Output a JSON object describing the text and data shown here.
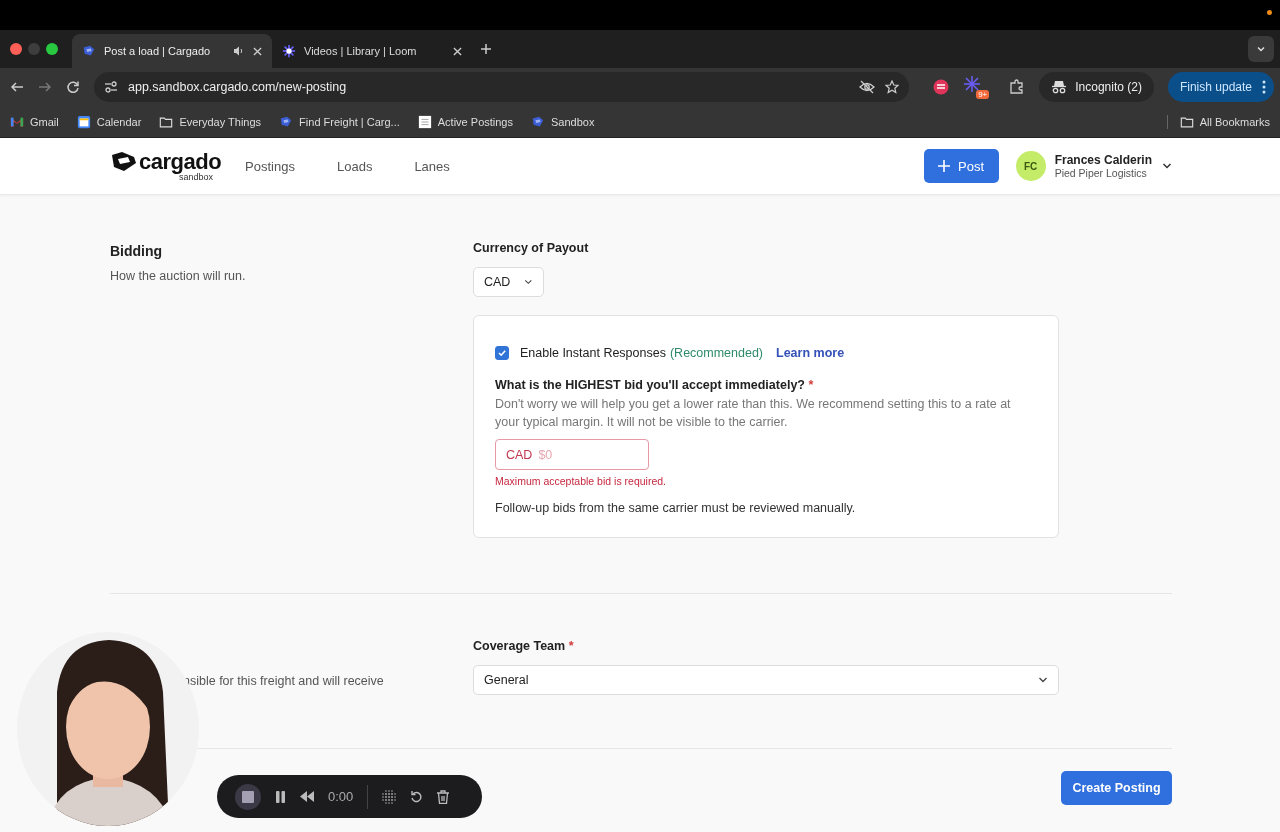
{
  "browser": {
    "tabs": [
      {
        "title": "Post a load | Cargado",
        "selected": true,
        "kind": "cargado"
      },
      {
        "title": "Videos | Library | Loom",
        "selected": false,
        "kind": "loom"
      }
    ],
    "url": "app.sandbox.cargado.com/new-posting",
    "extension_badge": "9+",
    "incognito": "Incognito (2)",
    "update_button": "Finish update",
    "bookmarks": [
      {
        "label": "Gmail",
        "kind": "gmail"
      },
      {
        "label": "Calendar",
        "kind": "calendar"
      },
      {
        "label": "Everyday Things",
        "kind": "folder"
      },
      {
        "label": "Find Freight | Carg...",
        "kind": "cargado"
      },
      {
        "label": "Active Postings",
        "kind": "page"
      },
      {
        "label": "Sandbox",
        "kind": "cargado"
      }
    ],
    "all_bookmarks": "All Bookmarks"
  },
  "header": {
    "logo": "cargado",
    "logo_sub": "sandbox",
    "nav": [
      "Postings",
      "Loads",
      "Lanes"
    ],
    "post_button": "Post",
    "user": {
      "initials": "FC",
      "name": "Frances Calderin",
      "company": "Pied Piper Logistics"
    }
  },
  "bidding": {
    "title": "Bidding",
    "description": "How the auction will run.",
    "currency_label": "Currency of Payout",
    "currency": "CAD",
    "instant": {
      "checked": true,
      "label": "Enable Instant Responses",
      "recommended": "(Recommended)",
      "link": "Learn more"
    },
    "question": "What is the HIGHEST bid you'll accept immediately?",
    "required": "*",
    "help": "Don't worry we will help you get a lower rate than this. We recommend setting this to a rate at your typical margin. It will not be visible to the carrier.",
    "bid_field": {
      "prefix": "CAD",
      "placeholder": "$0"
    },
    "error": "Maximum acceptable bid is required.",
    "note": "Follow-up bids from the same carrier must be reviewed manually."
  },
  "coverage": {
    "description": "nsible for this freight and will receive",
    "label": "Coverage Team",
    "required": "*",
    "value": "General"
  },
  "create_button": "Create Posting",
  "recorder": {
    "time": "0:00"
  }
}
